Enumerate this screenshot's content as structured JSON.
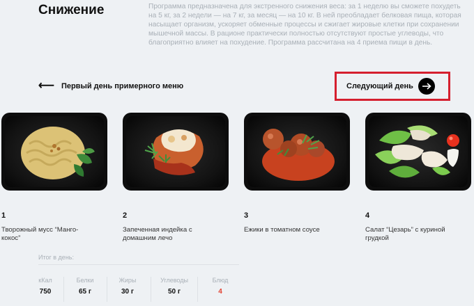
{
  "program": {
    "title": "Снижение",
    "description": "Программа предназначена для экстренного снижения веса: за 1 неделю вы сможете похудеть на 5 кг, за 2 недели — на 7 кг, за месяц — на 10 кг. В ней преобладает белковая пища, которая насыщает организм, ускоряет обменные процессы и сжигает жировые клетки при сохранении мышечной массы. В рационе практически полностью отсутствуют простые углеводы, что благоприятно влияет на похудение. Программа рассчитана на 4 приема пищи в день."
  },
  "navigation": {
    "prev_arrow": "⟵",
    "prev_label": "Первый день примерного меню",
    "next_label": "Следующий день",
    "next_icon": "arrow-right-icon"
  },
  "dishes": [
    {
      "number": "1",
      "name": "Творожный мусс “Манго-кокос”"
    },
    {
      "number": "2",
      "name": "Запеченная индейка с домашним лечо"
    },
    {
      "number": "3",
      "name": "Ежики в томатном соусе"
    },
    {
      "number": "4",
      "name": "Салат “Цезарь” с куриной грудкой"
    }
  ],
  "summary": {
    "title": "Итог в день:",
    "stats": [
      {
        "label": "кКал",
        "value": "750"
      },
      {
        "label": "Белки",
        "value": "65 г"
      },
      {
        "label": "Жиры",
        "value": "30 г"
      },
      {
        "label": "Углеводы",
        "value": "50 г"
      },
      {
        "label": "Блюд",
        "value": "4"
      }
    ]
  },
  "colors": {
    "highlight_border": "#d51f2e",
    "dish_count_value": "#e2402f",
    "background": "#eef1f4"
  }
}
